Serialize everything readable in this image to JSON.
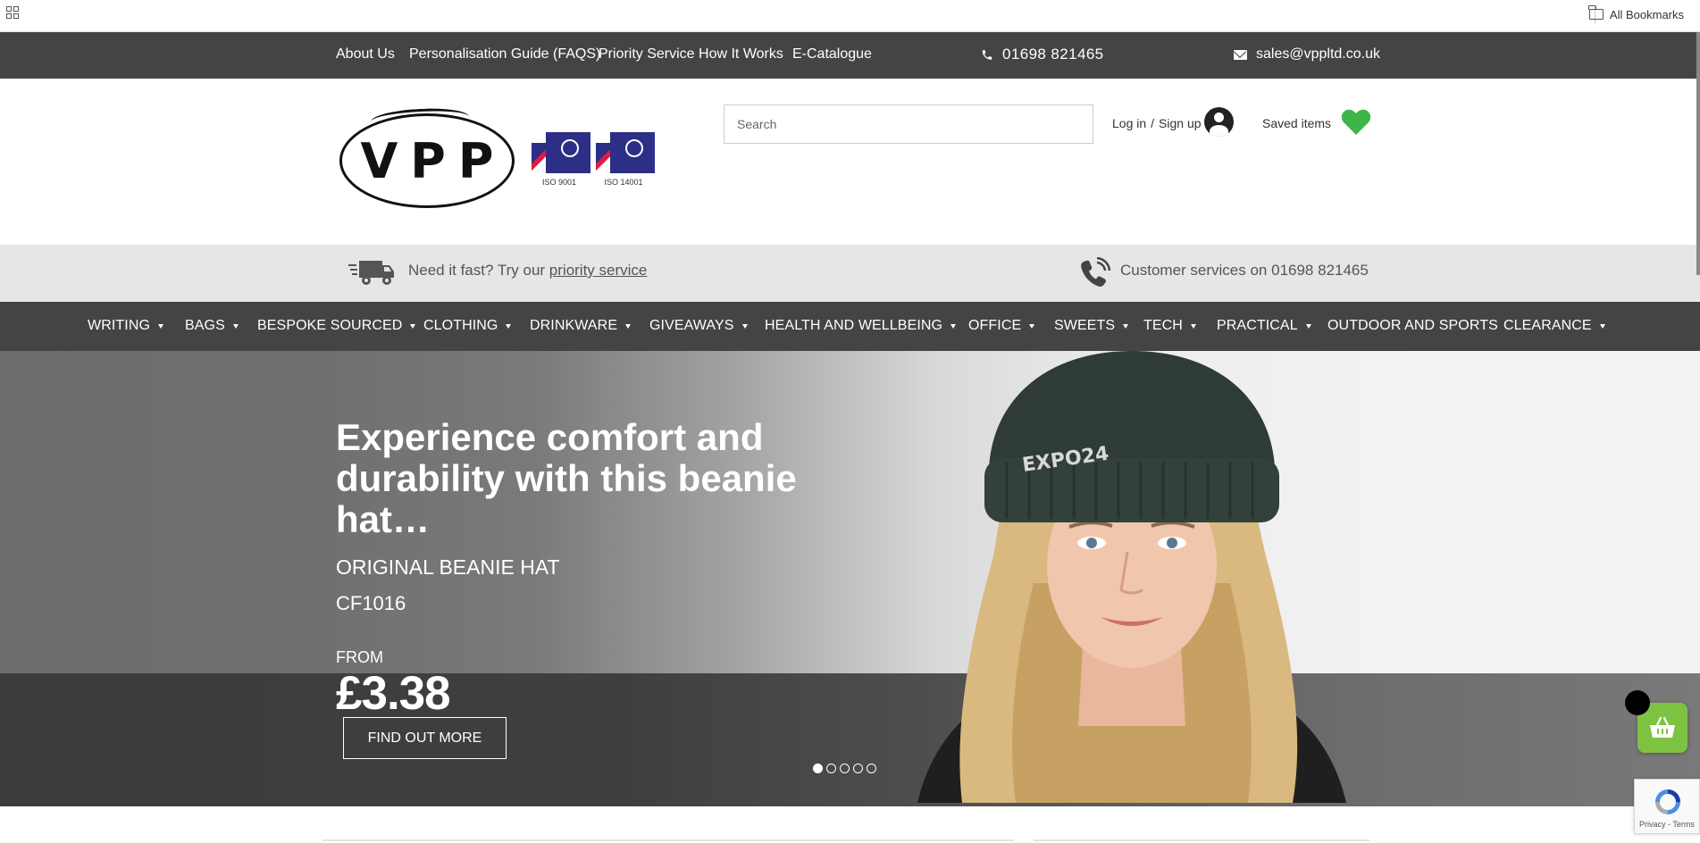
{
  "browser": {
    "all_bookmarks_label": "All Bookmarks"
  },
  "topbar": {
    "links": [
      "About Us",
      "Personalisation Guide (FAQS)",
      "Priority Service How It Works",
      "E-Catalogue"
    ],
    "phone": "01698 821465",
    "email": "sales@vppltd.co.uk"
  },
  "header": {
    "logo_text": "VPP",
    "certs": [
      {
        "label": "ISO 9001"
      },
      {
        "label": "ISO 14001"
      }
    ],
    "search_placeholder": "Search",
    "login_label": "Log in",
    "separator": "/",
    "signup_label": "Sign up",
    "saved_label": "Saved items"
  },
  "service_strip": {
    "fast_prefix": "Need it fast? Try our ",
    "fast_link": "priority service",
    "customer_services": "Customer services on 01698 821465"
  },
  "nav": {
    "items": [
      {
        "label": "WRITING",
        "dropdown": true
      },
      {
        "label": "BAGS",
        "dropdown": true
      },
      {
        "label": "BESPOKE SOURCED",
        "dropdown": true
      },
      {
        "label": "CLOTHING",
        "dropdown": true
      },
      {
        "label": "DRINKWARE",
        "dropdown": true
      },
      {
        "label": "GIVEAWAYS",
        "dropdown": true
      },
      {
        "label": "HEALTH AND WELLBEING",
        "dropdown": true
      },
      {
        "label": "OFFICE",
        "dropdown": true
      },
      {
        "label": "SWEETS",
        "dropdown": true
      },
      {
        "label": "TECH",
        "dropdown": true
      },
      {
        "label": "PRACTICAL",
        "dropdown": true
      },
      {
        "label": "OUTDOOR AND SPORTS",
        "dropdown": false
      },
      {
        "label": "CLEARANCE",
        "dropdown": true
      }
    ]
  },
  "hero": {
    "title": "Experience comfort and durability with this beanie hat…",
    "product_name": "ORIGINAL BEANIE HAT",
    "product_code": "CF1016",
    "from_label": "FROM",
    "price": "£3.38",
    "cta_label": "FIND OUT MORE",
    "beanie_logo_text": "EXPO24",
    "slides_total": 5,
    "active_slide": 1
  },
  "recaptcha": {
    "privacy": "Privacy",
    "terms": "Terms"
  },
  "colors": {
    "dark_bar": "#444444",
    "service_strip": "#e6e6e6",
    "heart_green": "#3fb549",
    "basket_green": "#7ec242"
  },
  "icons": [
    "apps-icon",
    "folder-icon",
    "phone-icon",
    "envelope-icon",
    "user-icon",
    "heart-icon",
    "van-icon",
    "phone-ring-icon",
    "basket-icon",
    "recaptcha-icon"
  ]
}
